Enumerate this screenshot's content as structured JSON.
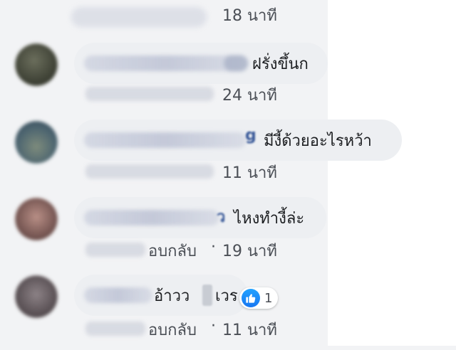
{
  "comments": [
    {
      "author_tail": "",
      "text": "",
      "meta": {
        "reply_label": "",
        "time": "18 นาที"
      },
      "reactions": null
    },
    {
      "author_tail": "",
      "text": "ฝรั่งขึ้นก",
      "meta": {
        "reply_label": "",
        "time": "24 นาที"
      },
      "reactions": null
    },
    {
      "author_tail": "g",
      "text": "มีงี้ด้วยอะไรหว้า",
      "meta": {
        "reply_label": "",
        "time": "11 นาที"
      },
      "reactions": null
    },
    {
      "author_tail": "ว",
      "text": "ไหงทำงี้ล่ะ",
      "meta": {
        "reply_label": "อบกลับ",
        "time": "19 นาที"
      },
      "reactions": null
    },
    {
      "author_tail": "",
      "text_part1": "อ้าวว",
      "text_part2": "เวร",
      "meta": {
        "reply_label": "อบกลับ",
        "time": "11 นาที"
      },
      "reactions": {
        "icon": "like-icon",
        "count": "1"
      }
    }
  ],
  "colors": {
    "background": "#f2f3f5",
    "bubble": "#edeff2",
    "name": "#385898",
    "text": "#1c1e21",
    "meta": "#4b4f56",
    "like": "#1877f2"
  }
}
